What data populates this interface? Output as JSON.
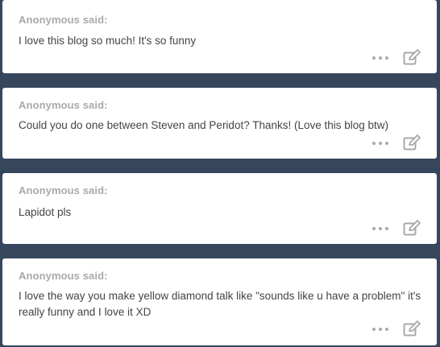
{
  "theme": {
    "background": "#36465d",
    "card": "#ffffff",
    "asker_color": "#a9a9a9",
    "text_color": "#444444"
  },
  "feed": {
    "items": [
      {
        "asker": "Anonymous said:",
        "question": "I love this blog so much! It's so funny",
        "icons": [
          "more-icon",
          "edit-icon"
        ]
      },
      {
        "asker": "Anonymous said:",
        "question": "Could you do one between Steven and Peridot? Thanks! (Love this blog btw)",
        "icons": [
          "more-icon",
          "edit-icon"
        ]
      },
      {
        "asker": "Anonymous said:",
        "question": "Lapidot pls",
        "icons": [
          "more-icon",
          "edit-icon"
        ]
      },
      {
        "asker": "Anonymous said:",
        "question": "I love the way you make yellow diamond talk like \"sounds like u have a problem\" it's really funny and I love it XD",
        "icons": [
          "more-icon",
          "edit-icon"
        ]
      }
    ]
  }
}
